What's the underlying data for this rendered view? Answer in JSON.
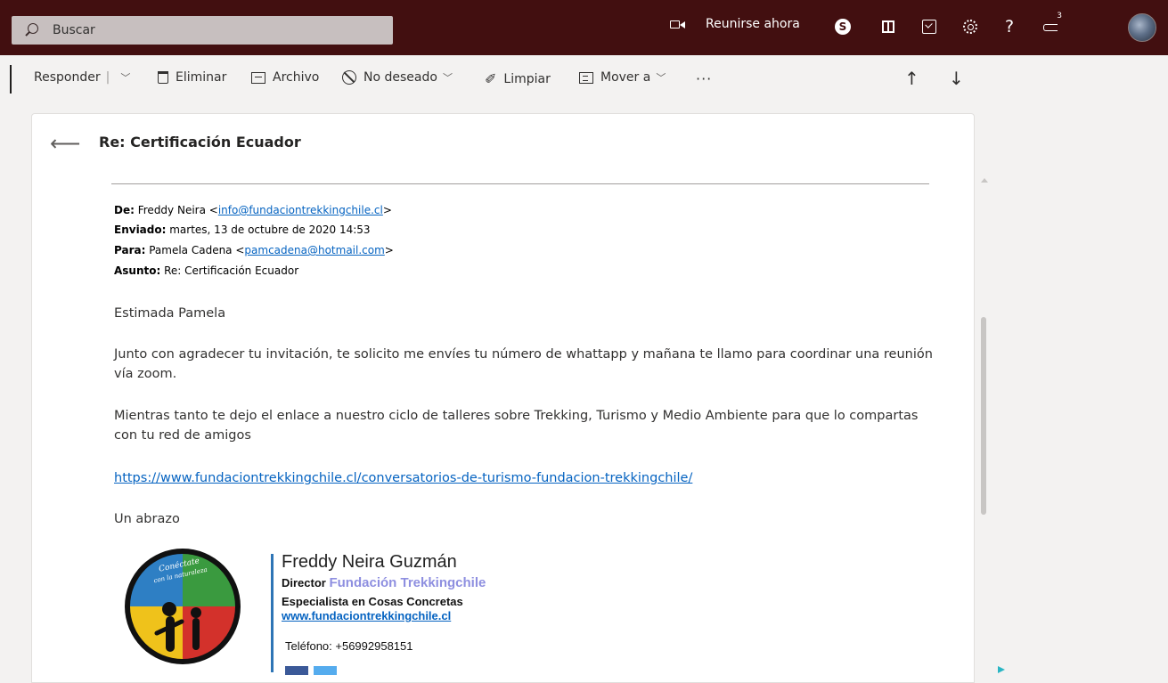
{
  "search": {
    "placeholder": "Buscar"
  },
  "topbar": {
    "meet_now": "Reunirse ahora",
    "help": "?",
    "notification_count": "3",
    "skype_glyph": "S"
  },
  "toolbar": {
    "reply": "Responder",
    "delete": "Eliminar",
    "archive": "Archivo",
    "junk": "No deseado",
    "sweep": "Limpiar",
    "move": "Mover a",
    "more": "···",
    "up": "↑",
    "down": "↓"
  },
  "message": {
    "subject": "Re: Certificación Ecuador",
    "from_label": "De:",
    "from_name": "Freddy Neira <",
    "from_email": "info@fundaciontrekkingchile.cl",
    "sent_label": "Enviado:",
    "sent_value": "martes, 13 de octubre de 2020 14:53",
    "to_label": "Para:",
    "to_name": "Pamela Cadena <",
    "to_email": "pamcadena@hotmail.com",
    "subject_label": "Asunto:",
    "subject_value": "Re: Certificación Ecuador",
    "greeting": "Estimada Pamela",
    "para1": "Junto con agradecer tu invitación, te solicito me envíes tu número de whattapp y mañana te llamo para coordinar una reunión vía zoom.",
    "para2": "Mientras tanto te dejo el enlace a nuestro ciclo de talleres sobre Trekking, Turismo y Medio Ambiente para que lo compartas con tu red de amigos",
    "link": "https://www.fundaciontrekkingchile.cl/conversatorios-de-turismo-fundacion-trekkingchile/",
    "closing": "Un abrazo"
  },
  "signature": {
    "name": "Freddy Neira Guzmán",
    "role": "Director",
    "org": "Fundación Trekkingchile",
    "tagline": "Especialista en Cosas Concretas",
    "website": "www.fundaciontrekkingchile.cl",
    "phone": "Teléfono: +56992958151",
    "logo_text1": "Conéctate",
    "logo_text2": "con la naturaleza"
  },
  "colors": {
    "topbar": "#420f10",
    "link": "#0563c1",
    "org": "#8e8fe0",
    "sig_bar": "#2e75b6"
  }
}
